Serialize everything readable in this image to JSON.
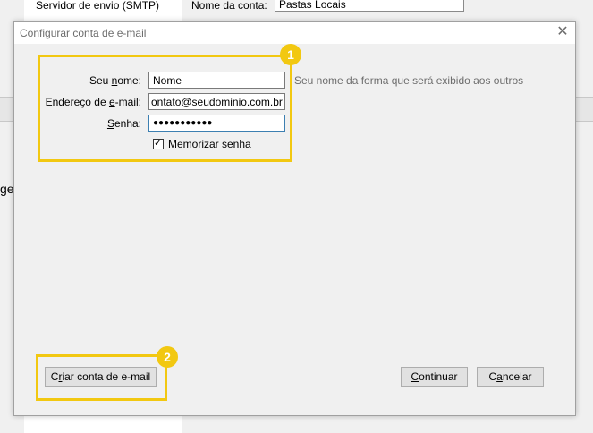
{
  "background": {
    "sidebar_item": "Servidor de envio (SMTP)",
    "account_name_label": "Nome da conta:",
    "account_name_value": "Pastas Locais",
    "cut_text": "ge"
  },
  "dialog": {
    "title": "Configurar conta de e-mail",
    "close_glyph": "✕",
    "name": {
      "label": "Seu nome:",
      "value": "Nome",
      "hint": "Seu nome da forma que será exibido aos outros"
    },
    "email": {
      "label": "Endereço de e-mail:",
      "value": "ontato@seudominio.com.br"
    },
    "password": {
      "label": "Senha:",
      "value": "●●●●●●●●●●●"
    },
    "remember": {
      "label": "Memorizar senha",
      "checked": true,
      "check_glyph": "✓"
    },
    "buttons": {
      "create": "Criar conta de e-mail",
      "continue": "Continuar",
      "cancel": "Cancelar"
    }
  },
  "callouts": [
    "1",
    "2"
  ],
  "colors": {
    "highlight": "#f2c811",
    "focus_border": "#3c7fb1"
  }
}
